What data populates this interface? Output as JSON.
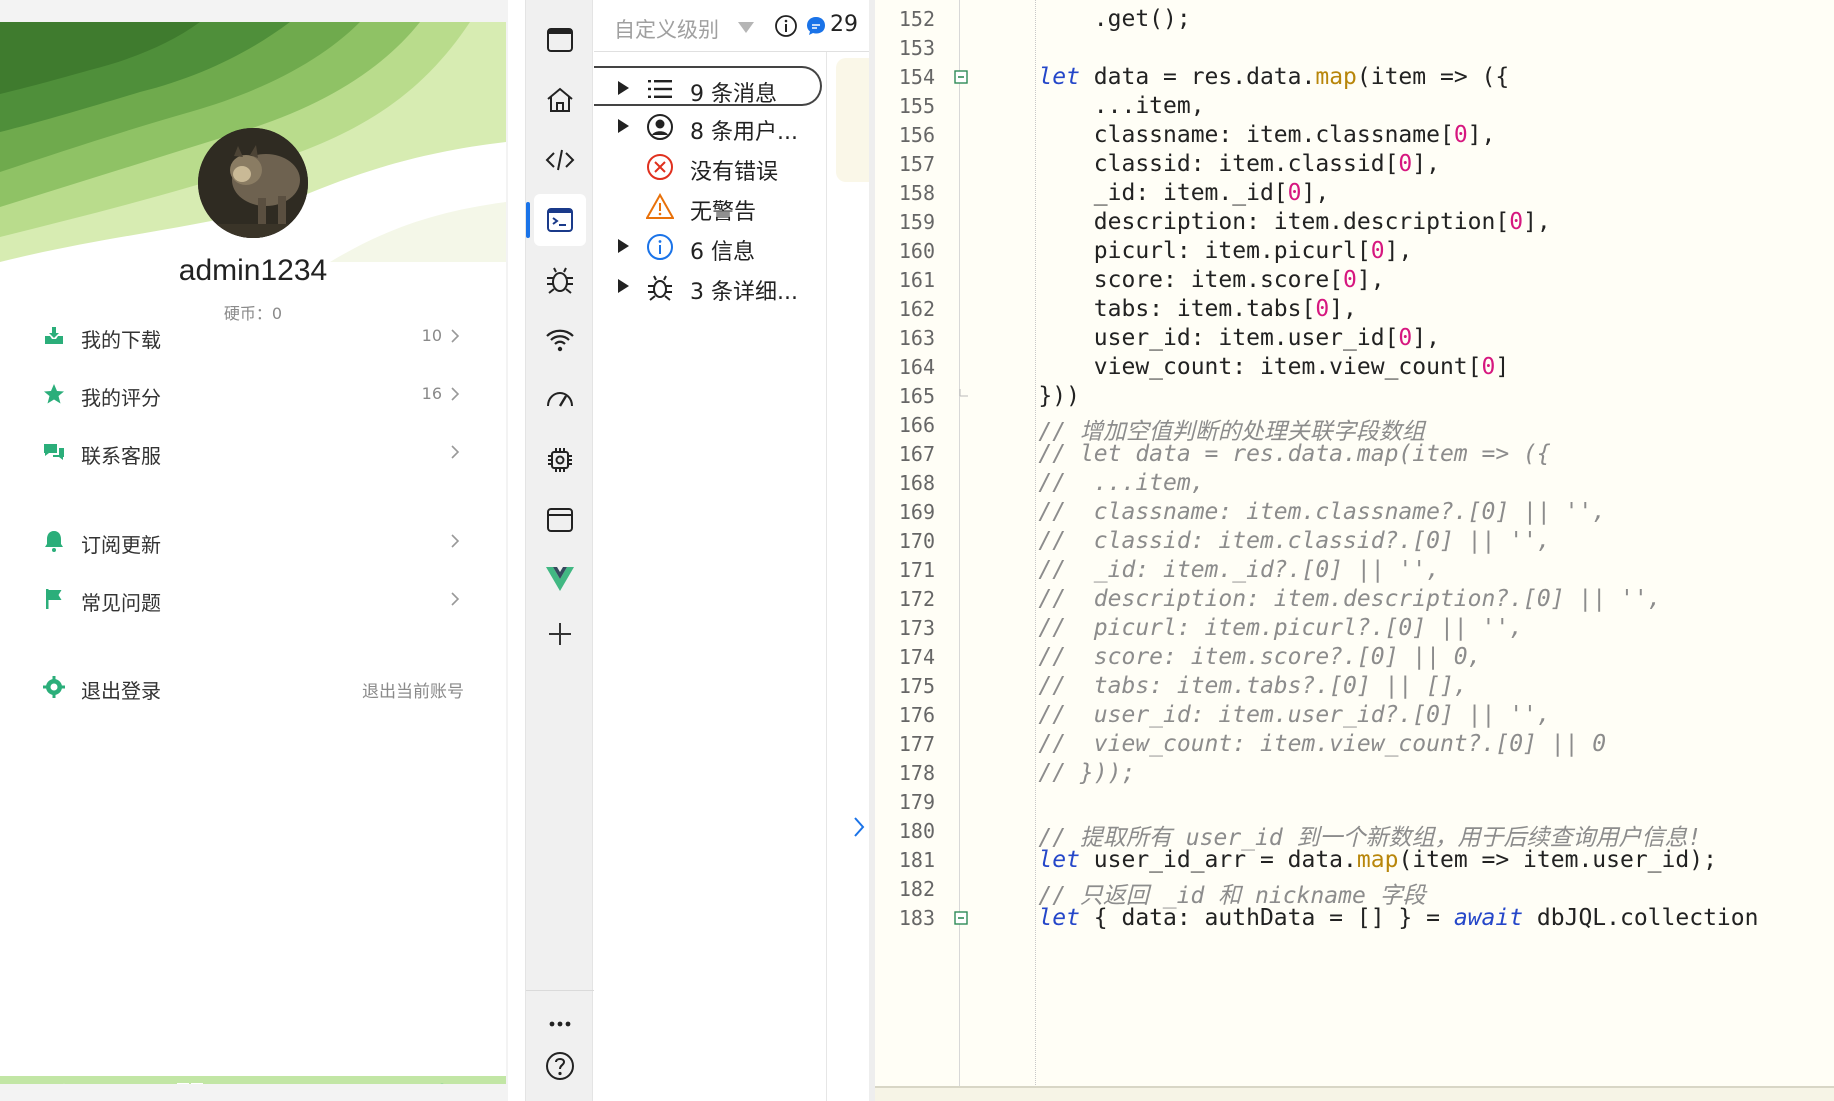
{
  "phone": {
    "username": "admin1234",
    "coins": "硬币：0",
    "menu": [
      {
        "label": "我的下载",
        "count": "10",
        "icon": "download-box-icon"
      },
      {
        "label": "我的评分",
        "count": "16",
        "icon": "star-icon"
      },
      {
        "label": "联系客服",
        "count": "",
        "icon": "chat-bubbles-icon"
      },
      {
        "label": "订阅更新",
        "count": "",
        "icon": "bell-icon"
      },
      {
        "label": "常见问题",
        "count": "",
        "icon": "flag-icon"
      },
      {
        "label": "退出登录",
        "sub": "退出当前账号",
        "icon": "gear-icon"
      }
    ],
    "accent": "#2bae7a",
    "tabbar_color": "#c2e6a5",
    "tabs": [
      "home-icon",
      "grid-icon",
      "image-icon",
      "user-icon"
    ]
  },
  "activity_bar": {
    "items": [
      "window-icon",
      "home-icon",
      "code-icon",
      "console-icon",
      "bug-icon",
      "wifi-icon",
      "performance-icon",
      "chip-icon",
      "window-icon",
      "vue-icon",
      "plus-icon",
      "more-icon",
      "help-icon"
    ],
    "active": "console-icon",
    "active_color": "#1a73e8"
  },
  "console": {
    "level_label": "自定义级别",
    "message_count": "29",
    "rows": [
      {
        "text": "9 条消息",
        "icon": "list-icon",
        "expandable": true
      },
      {
        "text": "8 条用户...",
        "icon": "user-circle-icon",
        "expandable": true
      },
      {
        "text": "没有错误",
        "icon": "error-icon",
        "expandable": false
      },
      {
        "text": "无警告",
        "icon": "warning-icon",
        "expandable": false
      },
      {
        "text": "6 信息",
        "icon": "info-icon",
        "expandable": true
      },
      {
        "text": "3 条详细...",
        "icon": "bug-icon",
        "expandable": true
      }
    ]
  },
  "editor": {
    "lines": [
      {
        "n": "152",
        "fold": "",
        "tokens": [
          [
            "pl",
            "        .get();"
          ]
        ]
      },
      {
        "n": "153",
        "fold": "",
        "tokens": [
          [
            "pl",
            ""
          ]
        ]
      },
      {
        "n": "154",
        "fold": "minus",
        "tokens": [
          [
            "kw",
            "    let"
          ],
          [
            "pl",
            " data = res.data."
          ],
          [
            "fn",
            "map"
          ],
          [
            "pl",
            "(item => ({"
          ]
        ]
      },
      {
        "n": "155",
        "fold": "",
        "tokens": [
          [
            "pl",
            "        ...item,"
          ]
        ]
      },
      {
        "n": "156",
        "fold": "",
        "tokens": [
          [
            "pl",
            "        classname: item.classname["
          ],
          [
            "num",
            "0"
          ],
          [
            "pl",
            "],"
          ]
        ]
      },
      {
        "n": "157",
        "fold": "",
        "tokens": [
          [
            "pl",
            "        classid: item.classid["
          ],
          [
            "num",
            "0"
          ],
          [
            "pl",
            "],"
          ]
        ]
      },
      {
        "n": "158",
        "fold": "",
        "tokens": [
          [
            "pl",
            "        _id: item._id["
          ],
          [
            "num",
            "0"
          ],
          [
            "pl",
            "],"
          ]
        ]
      },
      {
        "n": "159",
        "fold": "",
        "tokens": [
          [
            "pl",
            "        description: item.description["
          ],
          [
            "num",
            "0"
          ],
          [
            "pl",
            "],"
          ]
        ]
      },
      {
        "n": "160",
        "fold": "",
        "tokens": [
          [
            "pl",
            "        picurl: item.picurl["
          ],
          [
            "num",
            "0"
          ],
          [
            "pl",
            "],"
          ]
        ]
      },
      {
        "n": "161",
        "fold": "",
        "tokens": [
          [
            "pl",
            "        score: item.score["
          ],
          [
            "num",
            "0"
          ],
          [
            "pl",
            "],"
          ]
        ]
      },
      {
        "n": "162",
        "fold": "",
        "tokens": [
          [
            "pl",
            "        tabs: item.tabs["
          ],
          [
            "num",
            "0"
          ],
          [
            "pl",
            "],"
          ]
        ]
      },
      {
        "n": "163",
        "fold": "",
        "tokens": [
          [
            "pl",
            "        user_id: item.user_id["
          ],
          [
            "num",
            "0"
          ],
          [
            "pl",
            "],"
          ]
        ]
      },
      {
        "n": "164",
        "fold": "",
        "tokens": [
          [
            "pl",
            "        view_count: item.view_count["
          ],
          [
            "num",
            "0"
          ],
          [
            "pl",
            "]"
          ]
        ]
      },
      {
        "n": "165",
        "fold": "end",
        "tokens": [
          [
            "pl",
            "    }))"
          ]
        ]
      },
      {
        "n": "166",
        "fold": "",
        "tokens": [
          [
            "cm",
            "    // 增加空值判断的处理关联字段数组"
          ]
        ]
      },
      {
        "n": "167",
        "fold": "",
        "tokens": [
          [
            "cm",
            "    // let data = res.data.map(item => ({"
          ]
        ]
      },
      {
        "n": "168",
        "fold": "",
        "tokens": [
          [
            "cm",
            "    //  ...item,"
          ]
        ]
      },
      {
        "n": "169",
        "fold": "",
        "tokens": [
          [
            "cm",
            "    //  classname: item.classname?.[0] || '',"
          ]
        ]
      },
      {
        "n": "170",
        "fold": "",
        "tokens": [
          [
            "cm",
            "    //  classid: item.classid?.[0] || '',"
          ]
        ]
      },
      {
        "n": "171",
        "fold": "",
        "tokens": [
          [
            "cm",
            "    //  _id: item._id?.[0] || '',"
          ]
        ]
      },
      {
        "n": "172",
        "fold": "",
        "tokens": [
          [
            "cm",
            "    //  description: item.description?.[0] || '',"
          ]
        ]
      },
      {
        "n": "173",
        "fold": "",
        "tokens": [
          [
            "cm",
            "    //  picurl: item.picurl?.[0] || '',"
          ]
        ]
      },
      {
        "n": "174",
        "fold": "",
        "tokens": [
          [
            "cm",
            "    //  score: item.score?.[0] || 0,"
          ]
        ]
      },
      {
        "n": "175",
        "fold": "",
        "tokens": [
          [
            "cm",
            "    //  tabs: item.tabs?.[0] || [],"
          ]
        ]
      },
      {
        "n": "176",
        "fold": "",
        "tokens": [
          [
            "cm",
            "    //  user_id: item.user_id?.[0] || '',"
          ]
        ]
      },
      {
        "n": "177",
        "fold": "",
        "tokens": [
          [
            "cm",
            "    //  view_count: item.view_count?.[0] || 0"
          ]
        ]
      },
      {
        "n": "178",
        "fold": "",
        "tokens": [
          [
            "cm",
            "    // }));"
          ]
        ]
      },
      {
        "n": "179",
        "fold": "",
        "tokens": [
          [
            "pl",
            ""
          ]
        ]
      },
      {
        "n": "180",
        "fold": "",
        "tokens": [
          [
            "cm",
            "    // 提取所有 user_id 到一个新数组，用于后续查询用户信息!"
          ]
        ]
      },
      {
        "n": "181",
        "fold": "",
        "tokens": [
          [
            "kw",
            "    let"
          ],
          [
            "pl",
            " user_id_arr = data."
          ],
          [
            "fn",
            "map"
          ],
          [
            "pl",
            "(item => item.user_id);"
          ]
        ]
      },
      {
        "n": "182",
        "fold": "",
        "tokens": [
          [
            "cm",
            "    // 只返回 _id 和 nickname 字段"
          ]
        ]
      },
      {
        "n": "183",
        "fold": "minus",
        "tokens": [
          [
            "kw",
            "    let"
          ],
          [
            "pl",
            " { data: authData = [] } = "
          ],
          [
            "kw",
            "await"
          ],
          [
            "pl",
            " dbJQL.collection"
          ]
        ]
      }
    ]
  }
}
